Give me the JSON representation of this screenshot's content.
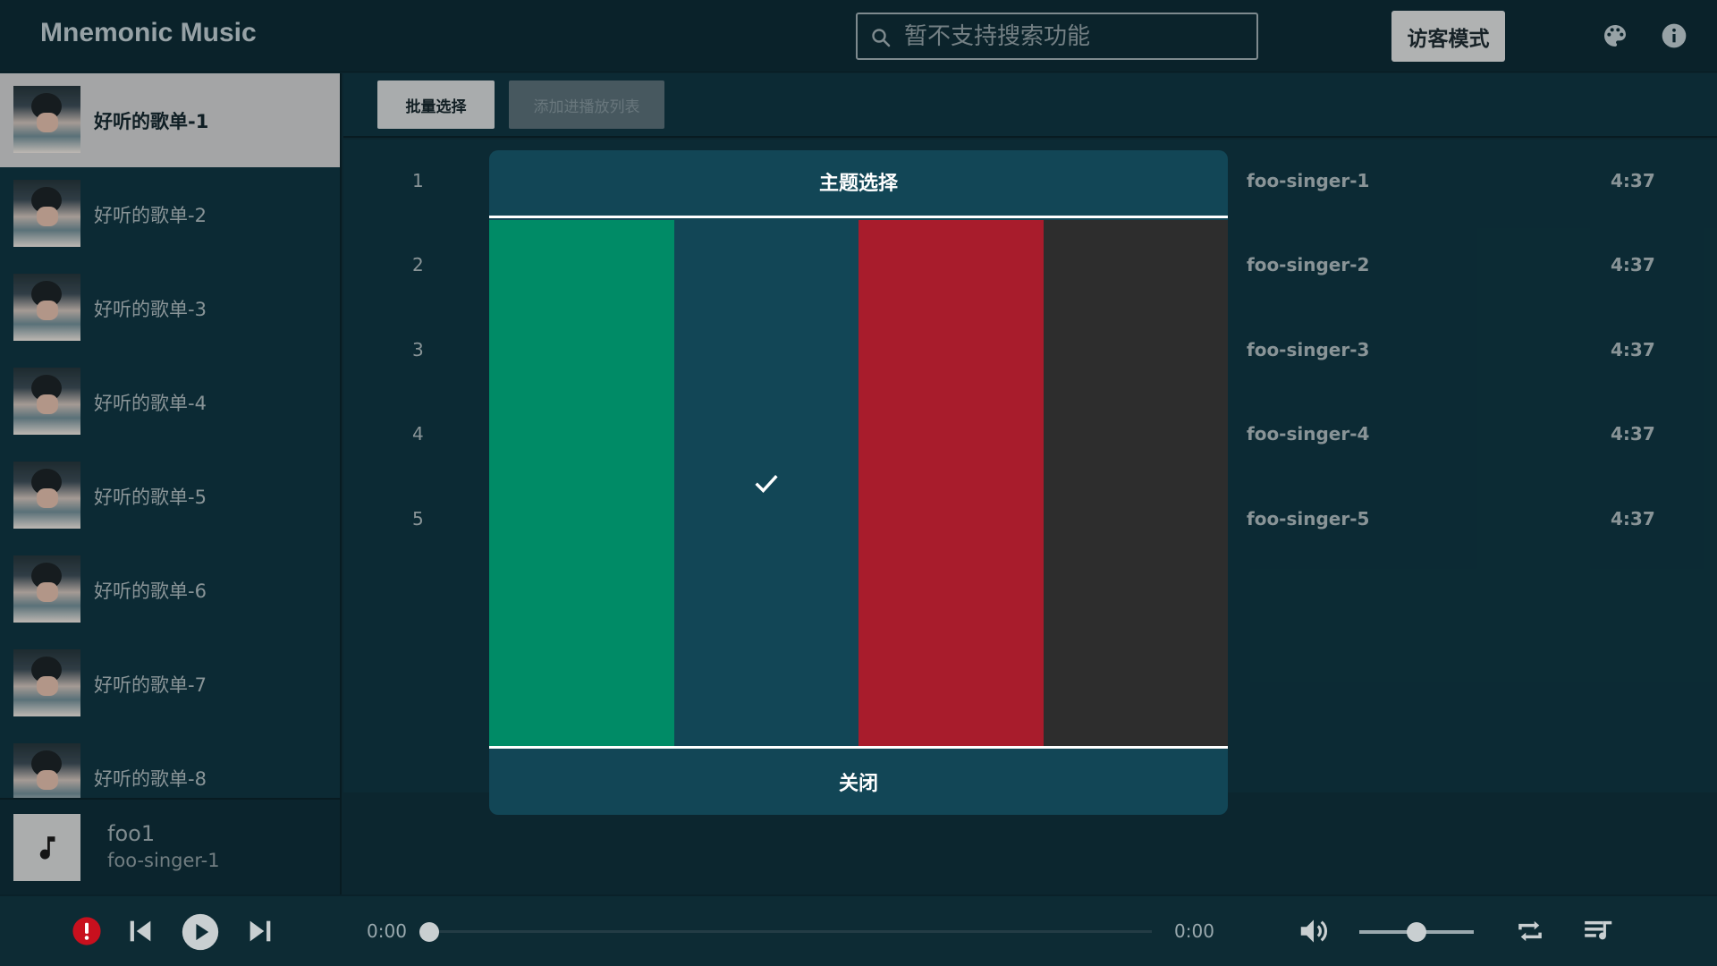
{
  "header": {
    "app_title": "Mnemonic Music",
    "search_placeholder": "暂不支持搜索功能",
    "guest_mode_label": "访客模式"
  },
  "sidebar": {
    "playlists": [
      {
        "label": "好听的歌单-1",
        "active": true
      },
      {
        "label": "好听的歌单-2",
        "active": false
      },
      {
        "label": "好听的歌单-3",
        "active": false
      },
      {
        "label": "好听的歌单-4",
        "active": false
      },
      {
        "label": "好听的歌单-5",
        "active": false
      },
      {
        "label": "好听的歌单-6",
        "active": false
      },
      {
        "label": "好听的歌单-7",
        "active": false
      },
      {
        "label": "好听的歌单-8",
        "active": false
      }
    ],
    "now_playing": {
      "title": "foo1",
      "artist": "foo-singer-1"
    }
  },
  "toolbar": {
    "batch_select_label": "批量选择",
    "add_to_playlist_label": "添加进播放列表"
  },
  "songs": [
    {
      "index": "1",
      "artist": "foo-singer-1",
      "duration": "4:37"
    },
    {
      "index": "2",
      "artist": "foo-singer-2",
      "duration": "4:37"
    },
    {
      "index": "3",
      "artist": "foo-singer-3",
      "duration": "4:37"
    },
    {
      "index": "4",
      "artist": "foo-singer-4",
      "duration": "4:37"
    },
    {
      "index": "5",
      "artist": "foo-singer-5",
      "duration": "4:37"
    }
  ],
  "theme_dialog": {
    "title": "主题选择",
    "close_label": "关闭",
    "swatches": [
      {
        "color": "#008b66",
        "selected": false
      },
      {
        "color": "#124656",
        "selected": true
      },
      {
        "color": "#a81c2c",
        "selected": false
      },
      {
        "color": "#2d2d2d",
        "selected": false
      }
    ]
  },
  "player": {
    "current_time": "0:00",
    "total_time": "0:00",
    "progress": 0,
    "volume": 0.5
  },
  "icons": {
    "search": "search-icon",
    "palette": "palette-icon",
    "info": "info-icon",
    "error": "error-icon",
    "prev": "skip-previous-icon",
    "play": "play-icon",
    "next": "skip-next-icon",
    "volume": "volume-icon",
    "repeat": "repeat-icon",
    "queue": "queue-music-icon",
    "music_note": "music-note-icon",
    "check": "check-icon"
  },
  "colors": {
    "background": "#0f3440",
    "header": "#0d2a34",
    "accent_error": "#c8101e"
  }
}
